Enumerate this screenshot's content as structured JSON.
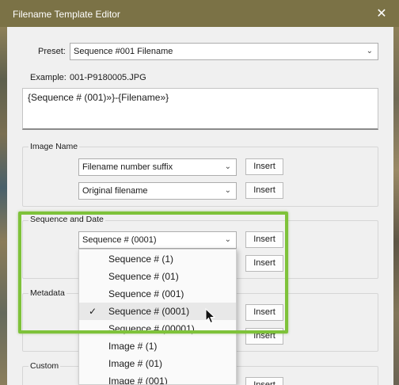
{
  "window": {
    "title": "Filename Template Editor",
    "close_icon": "close-icon"
  },
  "preset": {
    "label": "Preset:",
    "value": "Sequence #001 Filename"
  },
  "example": {
    "label": "Example:",
    "value": "001-P9180005.JPG"
  },
  "template_text": "{Sequence # (001)»}-{Filename»}",
  "image_name": {
    "title": "Image Name",
    "rows": [
      {
        "value": "Filename number suffix",
        "button": "Insert"
      },
      {
        "value": "Original filename",
        "button": "Insert"
      }
    ]
  },
  "sequence_and_date": {
    "title": "Sequence and Date",
    "rows": [
      {
        "value": "Sequence # (0001)",
        "button": "Insert"
      },
      {
        "value": "",
        "button": "Insert"
      }
    ]
  },
  "metadata": {
    "title": "Metadata",
    "buttons": [
      "Insert",
      "Insert"
    ]
  },
  "custom": {
    "title": "Custom",
    "button": "Insert"
  },
  "dropdown": {
    "items": [
      {
        "label": "Sequence # (1)",
        "selected": false
      },
      {
        "label": "Sequence # (01)",
        "selected": false
      },
      {
        "label": "Sequence # (001)",
        "selected": false
      },
      {
        "label": "Sequence # (0001)",
        "selected": true
      },
      {
        "label": "Sequence # (00001)",
        "selected": false
      },
      {
        "label": "Image # (1)",
        "selected": false
      },
      {
        "label": "Image # (01)",
        "selected": false
      },
      {
        "label": "Image # (001)",
        "selected": false
      }
    ],
    "check_mark": "✓"
  },
  "colors": {
    "titlebar": "#7b7246",
    "highlight": "#7ec23a"
  }
}
